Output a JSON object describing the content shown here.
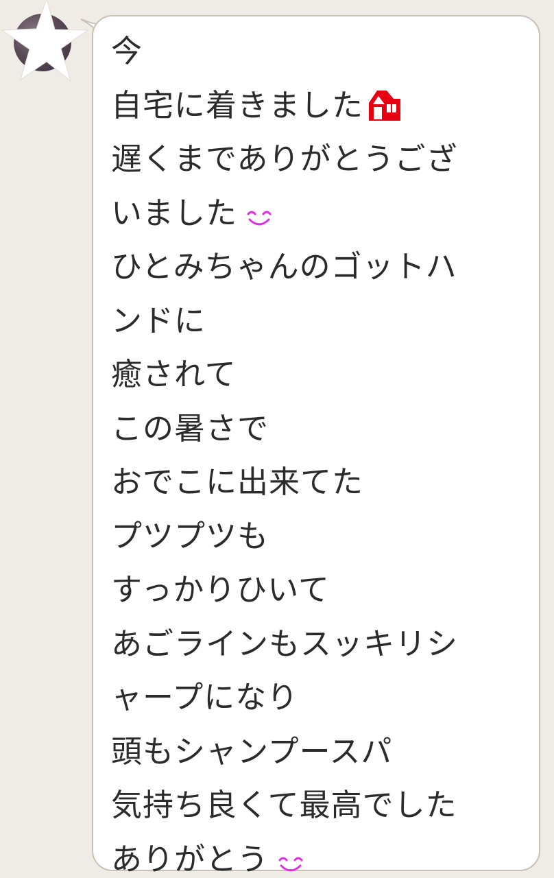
{
  "chat": {
    "message": {
      "lines": [
        {
          "text": "今"
        },
        {
          "text": "自宅に着きました",
          "emoji": "house-icon"
        },
        {
          "text": "遅くまでありがとうござ"
        },
        {
          "text": "いました",
          "emoji": "smile-icon"
        },
        {
          "text": "ひとみちゃんのゴットハ"
        },
        {
          "text": "ンドに"
        },
        {
          "text": "癒されて"
        },
        {
          "text": "この暑さで"
        },
        {
          "text": "おでこに出来てた"
        },
        {
          "text": "プツプツも"
        },
        {
          "text": "すっかりひいて"
        },
        {
          "text": "あごラインもスッキリシ"
        },
        {
          "text": "ャープになり"
        },
        {
          "text": "頭もシャンプースパ"
        },
        {
          "text": "気持ち良くて最高でした"
        },
        {
          "text": "ありがとう",
          "emoji": "smile-icon"
        }
      ]
    },
    "avatar": {
      "icon": "star-icon"
    },
    "colors": {
      "background": "#efebe5",
      "bubble": "#ffffff",
      "bubble_border": "#c8c1b6",
      "text": "#2b2b2b",
      "house_emoji": "#e60012",
      "smile_emoji": "#e02ee0"
    }
  }
}
